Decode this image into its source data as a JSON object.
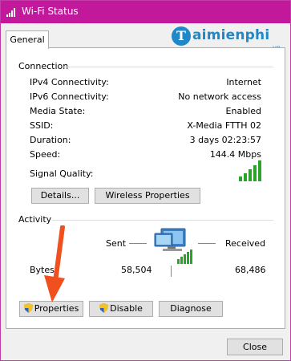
{
  "window": {
    "title": "Wi-Fi Status"
  },
  "logo": {
    "letter": "T",
    "word": "aimienphi",
    "suffix": ".vn"
  },
  "tabs": [
    {
      "label": "General"
    }
  ],
  "connection": {
    "heading": "Connection",
    "rows": [
      {
        "label": "IPv4 Connectivity:",
        "value": "Internet"
      },
      {
        "label": "IPv6 Connectivity:",
        "value": "No network access"
      },
      {
        "label": "Media State:",
        "value": "Enabled"
      },
      {
        "label": "SSID:",
        "value": "X-Media FTTH 02"
      },
      {
        "label": "Duration:",
        "value": "3 days 02:23:57"
      },
      {
        "label": "Speed:",
        "value": "144.4 Mbps"
      }
    ],
    "signal_label": "Signal Quality:",
    "signal_bars": 5,
    "details_button": "Details...",
    "wireless_button": "Wireless Properties"
  },
  "activity": {
    "heading": "Activity",
    "sent_label": "Sent",
    "received_label": "Received",
    "bytes_label": "Bytes:",
    "bytes_sent": "58,504",
    "bytes_received": "68,486"
  },
  "actions": {
    "properties": "Properties",
    "disable": "Disable",
    "diagnose": "Diagnose"
  },
  "close_button": "Close",
  "colors": {
    "title_bar": "#c2189b",
    "signal": "#2aa52a",
    "arrow": "#f0501e",
    "brand": "#1f88c8"
  }
}
